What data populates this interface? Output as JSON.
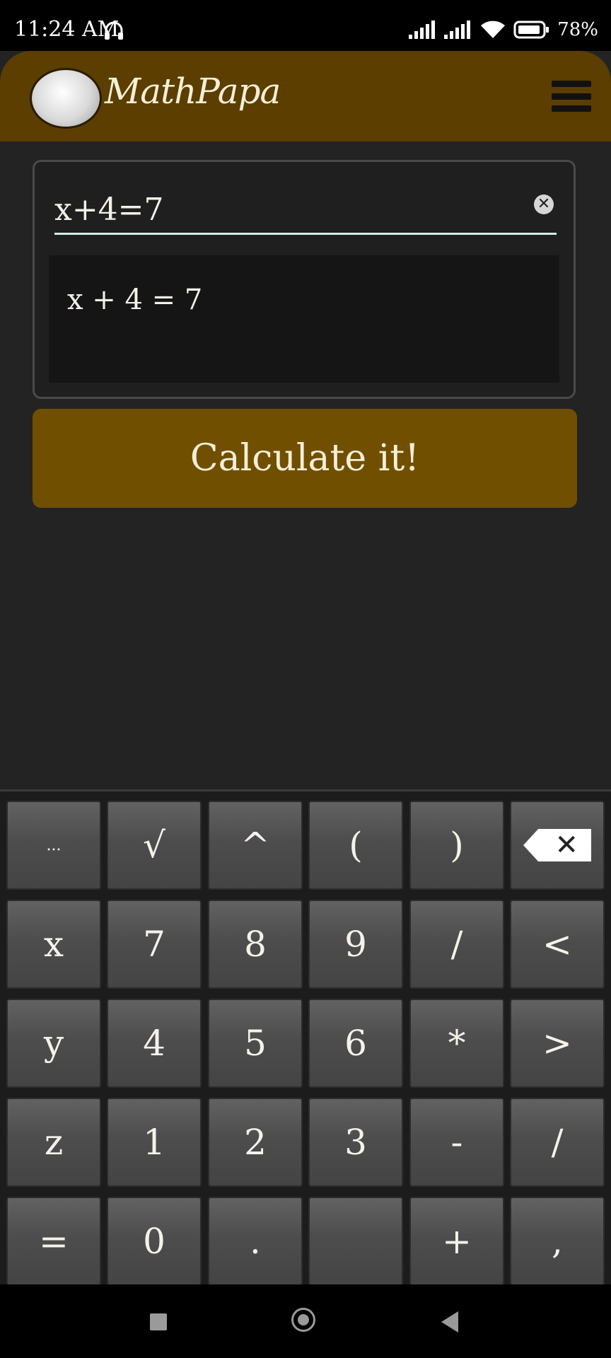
{
  "status_bar": {
    "time": "11:24 AM",
    "battery": "78%",
    "icons": [
      "headset-icon",
      "signal-icon",
      "signal-icon",
      "wifi-icon",
      "battery-icon"
    ]
  },
  "header": {
    "title": "MathPapa",
    "logo": "mathpapa-logo",
    "menu_icon": "hamburger-menu-icon",
    "color": "#5b3e00"
  },
  "input": {
    "value": "x+4=7",
    "preview": "x + 4 = 7"
  },
  "calculate_button": {
    "label": "Calculate it!",
    "color": "#714f00"
  },
  "keyboard": {
    "rows": [
      [
        "...",
        "√",
        "^",
        "(",
        ")",
        "⌫"
      ],
      [
        "x",
        "7",
        "8",
        "9",
        "/",
        "<"
      ],
      [
        "y",
        "4",
        "5",
        "6",
        "*",
        ">"
      ],
      [
        "z",
        "1",
        "2",
        "3",
        "-",
        "/"
      ],
      [
        "=",
        "0",
        ".",
        "",
        "+",
        ","
      ]
    ]
  },
  "nav_bar": {
    "icons": [
      "recent-apps-icon",
      "home-icon",
      "back-icon"
    ]
  }
}
